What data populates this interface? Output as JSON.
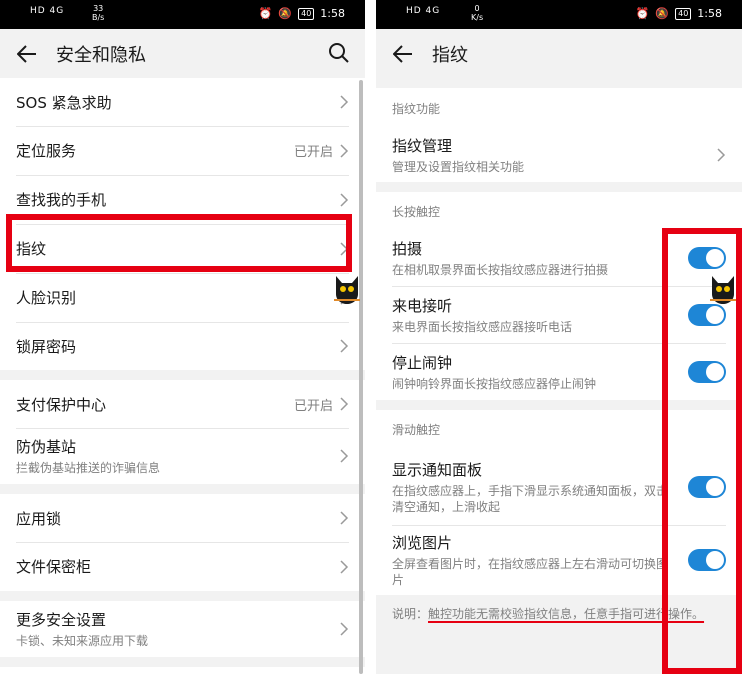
{
  "left": {
    "status": {
      "network": "HD 4G",
      "speed_value": "33",
      "speed_unit": "B/s",
      "battery": "40",
      "time": "1:58"
    },
    "title": "安全和隐私",
    "groups": [
      [
        {
          "label": "SOS 紧急求助"
        },
        {
          "label": "定位服务",
          "value": "已开启"
        },
        {
          "label": "查找我的手机"
        },
        {
          "label": "指纹"
        },
        {
          "label": "人脸识别"
        },
        {
          "label": "锁屏密码"
        }
      ],
      [
        {
          "label": "支付保护中心",
          "value": "已开启"
        },
        {
          "label": "防伪基站",
          "sub": "拦截伪基站推送的诈骗信息"
        }
      ],
      [
        {
          "label": "应用锁"
        },
        {
          "label": "文件保密柜"
        }
      ],
      [
        {
          "label": "更多安全设置",
          "sub": "卡锁、未知来源应用下载"
        }
      ]
    ]
  },
  "right": {
    "status": {
      "network": "HD 4G",
      "speed_value": "0",
      "speed_unit": "K/s",
      "battery": "40",
      "time": "1:58"
    },
    "title": "指纹",
    "sections": {
      "fingerprint_function": {
        "header": "指纹功能",
        "item": {
          "label": "指纹管理",
          "sub": "管理及设置指纹相关功能"
        }
      },
      "long_press": {
        "header": "长按触控",
        "items": [
          {
            "label": "拍摄",
            "sub": "在相机取景界面长按指纹感应器进行拍摄",
            "on": true
          },
          {
            "label": "来电接听",
            "sub": "来电界面长按指纹感应器接听电话",
            "on": true
          },
          {
            "label": "停止闹钟",
            "sub": "闹钟响铃界面长按指纹感应器停止闹钟",
            "on": true
          }
        ]
      },
      "swipe": {
        "header": "滑动触控",
        "items": [
          {
            "label": "显示通知面板",
            "sub": "在指纹感应器上，手指下滑显示系统通知面板，双击清空通知，上滑收起",
            "on": true
          },
          {
            "label": "浏览图片",
            "sub": "全屏查看图片时，在指纹感应器上左右滑动可切换图片",
            "on": true
          }
        ]
      }
    },
    "note": {
      "prefix": "说明：",
      "emphasis": "触控功能无需校验指纹信息，任意手指可进行操作。"
    }
  },
  "colors": {
    "accent": "#1e86d6",
    "highlight": "#e60012",
    "background": "#f2f2f2"
  }
}
